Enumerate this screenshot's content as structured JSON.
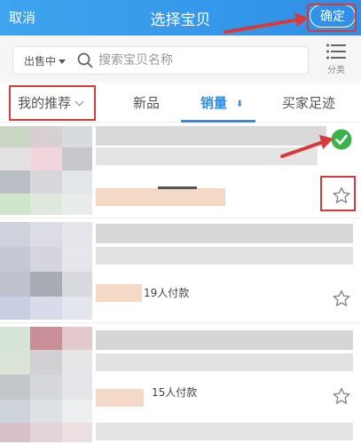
{
  "header": {
    "cancel_label": "取消",
    "title": "选择宝贝",
    "confirm_label": "确定"
  },
  "search": {
    "status_selected": "出售中",
    "placeholder": "搜索宝贝名称",
    "category_label": "分类"
  },
  "tabs": [
    {
      "label": "我的推荐",
      "active": false
    },
    {
      "label": "新品",
      "active": false
    },
    {
      "label": "销量",
      "active": true
    },
    {
      "label": "买家足迹",
      "active": false
    }
  ],
  "products": [
    {
      "paid_count": "",
      "selected": true,
      "favorite_icon": "star-outline"
    },
    {
      "paid_count": "19人付款",
      "selected": false,
      "favorite_icon": "star-outline"
    },
    {
      "paid_count": "15人付款",
      "selected": false,
      "favorite_icon": "star-outline"
    }
  ],
  "colors": {
    "header_blue": "#2f8fe6",
    "active_tab": "#2f8fe6",
    "check_green": "#3cb34a",
    "annotation_red": "#d83a3a"
  }
}
